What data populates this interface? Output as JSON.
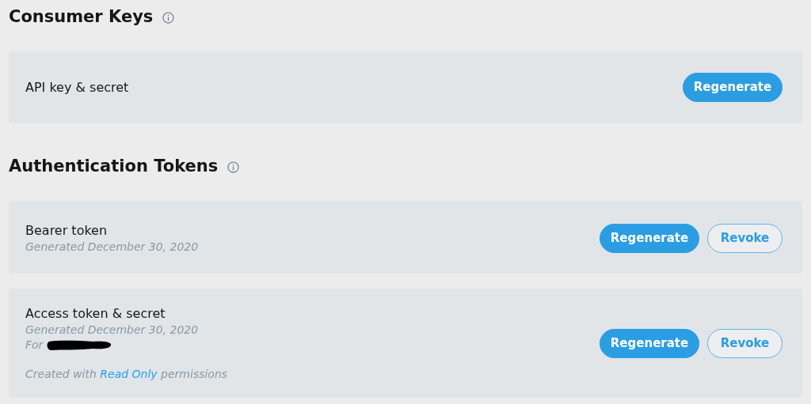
{
  "sections": [
    {
      "title": "Consumer Keys",
      "cards": [
        {
          "lines": [
            {
              "kind": "title",
              "text": "API key & secret"
            }
          ],
          "buttons": [
            {
              "kind": "primary",
              "label": "Regenerate"
            }
          ]
        }
      ]
    },
    {
      "title": "Authentication Tokens",
      "cards": [
        {
          "lines": [
            {
              "kind": "title",
              "text": "Bearer token"
            },
            {
              "kind": "meta",
              "text": "Generated December 30, 2020"
            }
          ],
          "buttons": [
            {
              "kind": "primary",
              "label": "Regenerate"
            },
            {
              "kind": "outline",
              "label": "Revoke"
            }
          ]
        },
        {
          "lines": [
            {
              "kind": "title",
              "text": "Access token & secret"
            },
            {
              "kind": "meta",
              "text": "Generated December 30, 2020"
            },
            {
              "kind": "redacted",
              "text": "For"
            },
            {
              "kind": "note",
              "prefix": "Created with",
              "link": "Read Only",
              "suffix": "permissions"
            }
          ],
          "buttons": [
            {
              "kind": "primary",
              "label": "Regenerate"
            },
            {
              "kind": "outline",
              "label": "Revoke"
            }
          ]
        }
      ]
    }
  ]
}
